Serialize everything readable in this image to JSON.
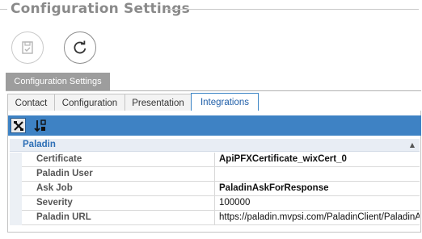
{
  "header": {
    "title": "Configuration Settings"
  },
  "actions": {
    "save_icon": "save-icon",
    "refresh_icon": "refresh-icon"
  },
  "group_tab": {
    "label": "Configuration Settings"
  },
  "tabs": [
    {
      "label": "Contact"
    },
    {
      "label": "Configuration"
    },
    {
      "label": "Presentation"
    },
    {
      "label": "Integrations",
      "active": true
    }
  ],
  "toolbar": {
    "categorized_icon": "categorized-icon",
    "sort_icon": "sort-alpha-icon"
  },
  "property_grid": {
    "category": "Paladin",
    "rows": [
      {
        "name": "Certificate",
        "value": "ApiPFXCertificate_wixCert_0"
      },
      {
        "name": "Paladin User",
        "value": ""
      },
      {
        "name": "Ask Job",
        "value": "PaladinAskForResponse"
      },
      {
        "name": "Severity",
        "value": "100000"
      },
      {
        "name": "Paladin URL",
        "value": "https://paladin.mvpsi.com/PaladinClient/PaladinApi"
      }
    ]
  },
  "colors": {
    "accent": "#3e82c4",
    "category_text": "#2d6fb6",
    "active_tab_text": "#1f5ea8"
  }
}
